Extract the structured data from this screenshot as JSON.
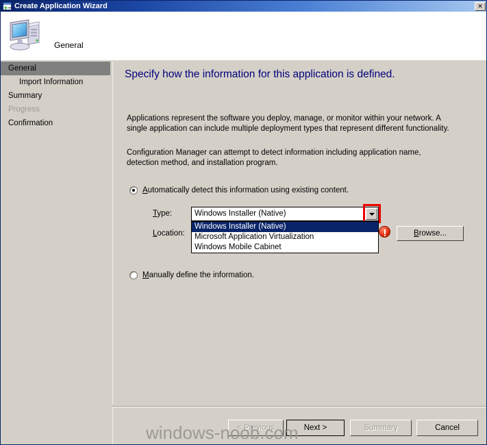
{
  "window": {
    "title": "Create Application Wizard",
    "title_icon": "wizard-window-icon",
    "close_label": "✕"
  },
  "header": {
    "icon": "computer-icon",
    "label": "General"
  },
  "sidebar": {
    "items": [
      {
        "label": "General",
        "state": "selected"
      },
      {
        "label": "Import Information",
        "state": "sub"
      },
      {
        "label": "Summary",
        "state": "normal"
      },
      {
        "label": "Progress",
        "state": "disabled"
      },
      {
        "label": "Confirmation",
        "state": "normal"
      }
    ]
  },
  "main": {
    "heading": "Specify how the information for this application is defined.",
    "paragraph_1": "Applications represent the software you deploy, manage, or monitor within your network. A single application can include multiple deployment types that represent different functionality.",
    "paragraph_2": "Configuration Manager can attempt to detect information including application name, detection method, and installation program.",
    "radio_auto": {
      "accel": "A",
      "rest": "utomatically detect this information using existing content.",
      "checked": true
    },
    "radio_manual": {
      "accel": "M",
      "rest": "anually define the information.",
      "checked": false
    },
    "type_label": {
      "accel": "T",
      "rest": "ype:"
    },
    "location_label": {
      "accel": "L",
      "rest": "ocation:"
    },
    "combo": {
      "value": "Windows Installer (Native)",
      "arrow_icon": "chevron-down-icon",
      "open": true,
      "options": [
        {
          "label": "Windows Installer (Native)",
          "selected": true
        },
        {
          "label": "Microsoft Application Virtualization",
          "selected": false
        },
        {
          "label": "Windows Mobile Cabinet",
          "selected": false
        }
      ]
    },
    "error_icon": "error-exclamation-icon",
    "browse_button": {
      "accel": "B",
      "rest": "rowse..."
    }
  },
  "footer": {
    "buttons": [
      {
        "label": "< Previous",
        "state": "disabled"
      },
      {
        "label": "Next >",
        "state": "default"
      },
      {
        "label": "Summary",
        "state": "disabled"
      },
      {
        "label": "Cancel",
        "state": "enabled"
      }
    ]
  },
  "watermark": "windows-noob.com",
  "colors": {
    "titlebar_start": "#0a246a",
    "titlebar_end": "#a6c8f0",
    "dialog_face": "#d4d0c8",
    "heading_text": "#00007a",
    "selection_blue": "#0a246a",
    "highlight_red": "#ee0000",
    "error_red": "#e8330f",
    "sidebar_selected": "#808080",
    "disabled_text": "#9a9a92"
  }
}
